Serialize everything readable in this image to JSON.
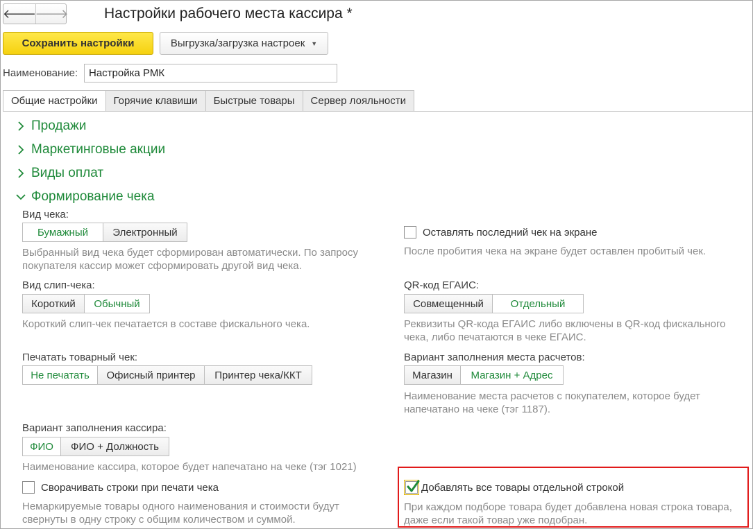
{
  "window": {
    "title": "Настройки рабочего места кассира *"
  },
  "nav": {
    "back_glyph": "🡐",
    "forward_glyph": "🡒"
  },
  "toolbar": {
    "save_label": "Сохранить настройки",
    "export_label": "Выгрузка/загрузка настроек"
  },
  "name_field": {
    "label": "Наименование:",
    "value": "Настройка РМК"
  },
  "tabs": [
    {
      "label": "Общие настройки",
      "active": true
    },
    {
      "label": "Горячие клавиши",
      "active": false
    },
    {
      "label": "Быстрые товары",
      "active": false
    },
    {
      "label": "Сервер лояльности",
      "active": false
    }
  ],
  "sections": [
    {
      "label": "Продажи",
      "expanded": false
    },
    {
      "label": "Маркетинговые акции",
      "expanded": false
    },
    {
      "label": "Виды оплат",
      "expanded": false
    },
    {
      "label": "Формирование чека",
      "expanded": true
    }
  ],
  "receipt_type": {
    "label": "Вид чека:",
    "options": [
      "Бумажный",
      "Электронный"
    ],
    "selected": "Бумажный",
    "hint_line1": "Выбранный вид чека будет сформирован автоматически. По запросу",
    "hint_line2": "покупателя кассир может сформировать другой вид чека."
  },
  "keep_last_receipt": {
    "label": "Оставлять последний чек на экране",
    "checked": false,
    "hint": "После пробития чека на экране будет оставлен пробитый чек."
  },
  "slip_type": {
    "label": "Вид слип-чека:",
    "options": [
      "Короткий",
      "Обычный"
    ],
    "selected": "Обычный",
    "hint": "Короткий слип-чек печатается  в составе фискального чека."
  },
  "qr_egais": {
    "label": "QR-код ЕГАИС:",
    "options": [
      "Совмещенный",
      "Отдельный"
    ],
    "selected": "Отдельный",
    "hint_line1": "Реквизиты QR-кода ЕГАИС либо включены в QR-код фискального",
    "hint_line2": "чека, либо печатаются в чеке ЕГАИС."
  },
  "print_sales_receipt": {
    "label": "Печатать товарный чек:",
    "options": [
      "Не печатать",
      "Офисный принтер",
      "Принтер чека/ККТ"
    ],
    "selected": "Не печатать"
  },
  "settlement_place": {
    "label": "Вариант заполнения места расчетов:",
    "options": [
      "Магазин",
      "Магазин + Адрес"
    ],
    "selected": "Магазин + Адрес",
    "hint_line1": "Наименование места расчетов с покупателем, которое будет",
    "hint_line2": "напечатано на чеке (тэг 1187)."
  },
  "cashier_fill": {
    "label": "Вариант заполнения кассира:",
    "options": [
      "ФИО",
      "ФИО + Должность"
    ],
    "selected": "ФИО",
    "hint": "Наименование кассира, которое будет напечатано на чеке (тэг 1021)"
  },
  "collapse_rows": {
    "label": "Сворачивать строки при печати чека",
    "checked": false,
    "hint_line1": "Немаркируемые товары одного наименования и стоимости будут",
    "hint_line2": "свернуты в одну строку с общим количеством и суммой."
  },
  "add_separate_row": {
    "label": "Добавлять все товары отдельной строкой",
    "checked": true,
    "hint_line1": "При каждом подборе товара будет добавлена новая строка товара,",
    "hint_line2": "даже если такой товар уже подобран."
  },
  "colors": {
    "accent_green": "#1f8a3a",
    "save_yellow": "#f5d10f",
    "highlight_red": "#e11a1a"
  }
}
